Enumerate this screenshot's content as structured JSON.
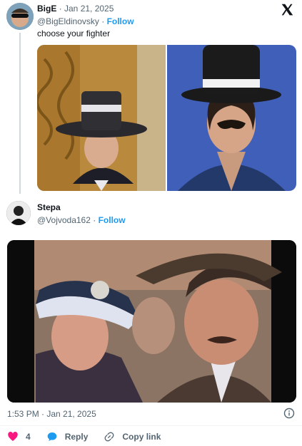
{
  "tweet1": {
    "author_name": "BigE",
    "sep_date": " · Jan 21, 2025",
    "handle": "@BigEldinovsky",
    "sep": " · ",
    "follow": "Follow",
    "text": "choose your fighter"
  },
  "tweet2": {
    "author_name": "Stepa",
    "handle": "@Vojvoda162",
    "sep": " · ",
    "follow": "Follow",
    "timestamp": "1:53 PM · Jan 21, 2025"
  },
  "actions": {
    "like_count": "4",
    "reply": "Reply",
    "copy_link": "Copy link"
  },
  "colors": {
    "like": "#f91880",
    "reply": "#1d9bf0",
    "follow": "#1d9bf0"
  },
  "icons": [
    "x-logo-icon",
    "info-icon",
    "heart-icon",
    "reply-bubble-icon",
    "link-icon"
  ]
}
